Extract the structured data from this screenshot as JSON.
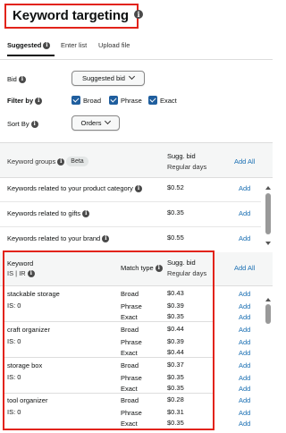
{
  "title": "Keyword targeting",
  "tabs": [
    {
      "label": "Suggested",
      "active": true
    },
    {
      "label": "Enter list",
      "active": false
    },
    {
      "label": "Upload file",
      "active": false
    }
  ],
  "bid": {
    "label": "Bid",
    "value": "Suggested bid"
  },
  "filter": {
    "label": "Filter by",
    "options": [
      {
        "label": "Broad",
        "checked": true
      },
      {
        "label": "Phrase",
        "checked": true
      },
      {
        "label": "Exact",
        "checked": true
      }
    ]
  },
  "sort": {
    "label": "Sort By",
    "value": "Orders"
  },
  "groups": {
    "header_label": "Keyword groups",
    "beta": "Beta",
    "bid_header": "Sugg. bid",
    "bid_sub": "Regular days",
    "add_all": "Add All",
    "rows": [
      {
        "label": "Keywords related to your product category",
        "bid": "$0.52",
        "action": "Add"
      },
      {
        "label": "Keywords related to gifts",
        "bid": "$0.35",
        "action": "Add"
      },
      {
        "label": "Keywords related to your brand",
        "bid": "$0.55",
        "action": "Add"
      }
    ]
  },
  "keywords": {
    "header_keyword": "Keyword",
    "header_sub": "IS | IR",
    "header_match": "Match type",
    "bid_header": "Sugg. bid",
    "bid_sub": "Regular days",
    "add_all": "Add All",
    "rows": [
      {
        "keyword": "stackable storage",
        "is": "IS: 0",
        "matches": [
          {
            "type": "Broad",
            "bid": "$0.43"
          },
          {
            "type": "Phrase",
            "bid": "$0.39"
          },
          {
            "type": "Exact",
            "bid": "$0.35"
          }
        ]
      },
      {
        "keyword": "craft organizer",
        "is": "IS: 0",
        "matches": [
          {
            "type": "Broad",
            "bid": "$0.44"
          },
          {
            "type": "Phrase",
            "bid": "$0.39"
          },
          {
            "type": "Exact",
            "bid": "$0.44"
          }
        ]
      },
      {
        "keyword": "storage box",
        "is": "IS: 0",
        "matches": [
          {
            "type": "Broad",
            "bid": "$0.37"
          },
          {
            "type": "Phrase",
            "bid": "$0.35"
          },
          {
            "type": "Exact",
            "bid": "$0.35"
          }
        ]
      },
      {
        "keyword": "tool organizer",
        "is": "IS: 0",
        "matches": [
          {
            "type": "Broad",
            "bid": "$0.28"
          },
          {
            "type": "Phrase",
            "bid": "$0.31"
          },
          {
            "type": "Exact",
            "bid": "$0.35"
          }
        ]
      }
    ],
    "add_label": "Add"
  },
  "colors": {
    "accent_blue": "#1a6fb3",
    "checkbox": "#1f5e9e",
    "highlight_red": "#e2231a"
  }
}
